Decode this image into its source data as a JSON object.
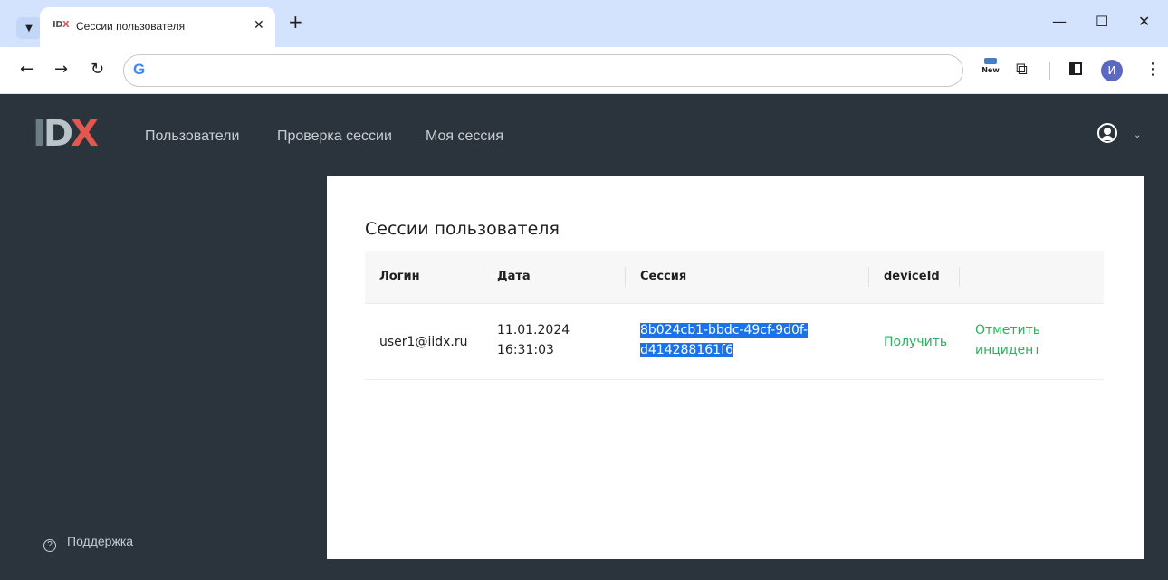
{
  "browser": {
    "tab_title": "Сессии пользователя",
    "tab_favicon": "IDX",
    "new_badge": "New",
    "profile_initial": "И",
    "icons": [
      "tab-search-icon",
      "close-icon",
      "new-tab-icon",
      "minimize-icon",
      "maximize-icon",
      "close-window-icon",
      "back-icon",
      "forward-icon",
      "reload-icon",
      "google-icon",
      "extensions-icon",
      "side-panel-icon",
      "more-icon"
    ]
  },
  "header": {
    "logo": "IDX",
    "nav": [
      "Пользователи",
      "Проверка сессии",
      "Моя сессия"
    ]
  },
  "sidebar": {
    "support_label": "Поддержка"
  },
  "main": {
    "title": "Сессии пользователя",
    "columns": [
      "Логин",
      "Дата",
      "Сессия",
      "deviceId"
    ],
    "rows": [
      {
        "login": "user1@iidx.ru",
        "date_line1": "11.01.2024",
        "date_line2": "16:31:03",
        "session_line1": "8b024cb1-bbdc-49cf-9d0f-",
        "session_line2": "d414288161f6",
        "device_action": "Получить",
        "incident_line1": "Отметить",
        "incident_line2": "инцидент"
      }
    ]
  },
  "colors": {
    "app_bg": "#2b343d",
    "link": "#2fae5e",
    "selection": "#1a73e8",
    "logo_accent": "#e4574f"
  }
}
